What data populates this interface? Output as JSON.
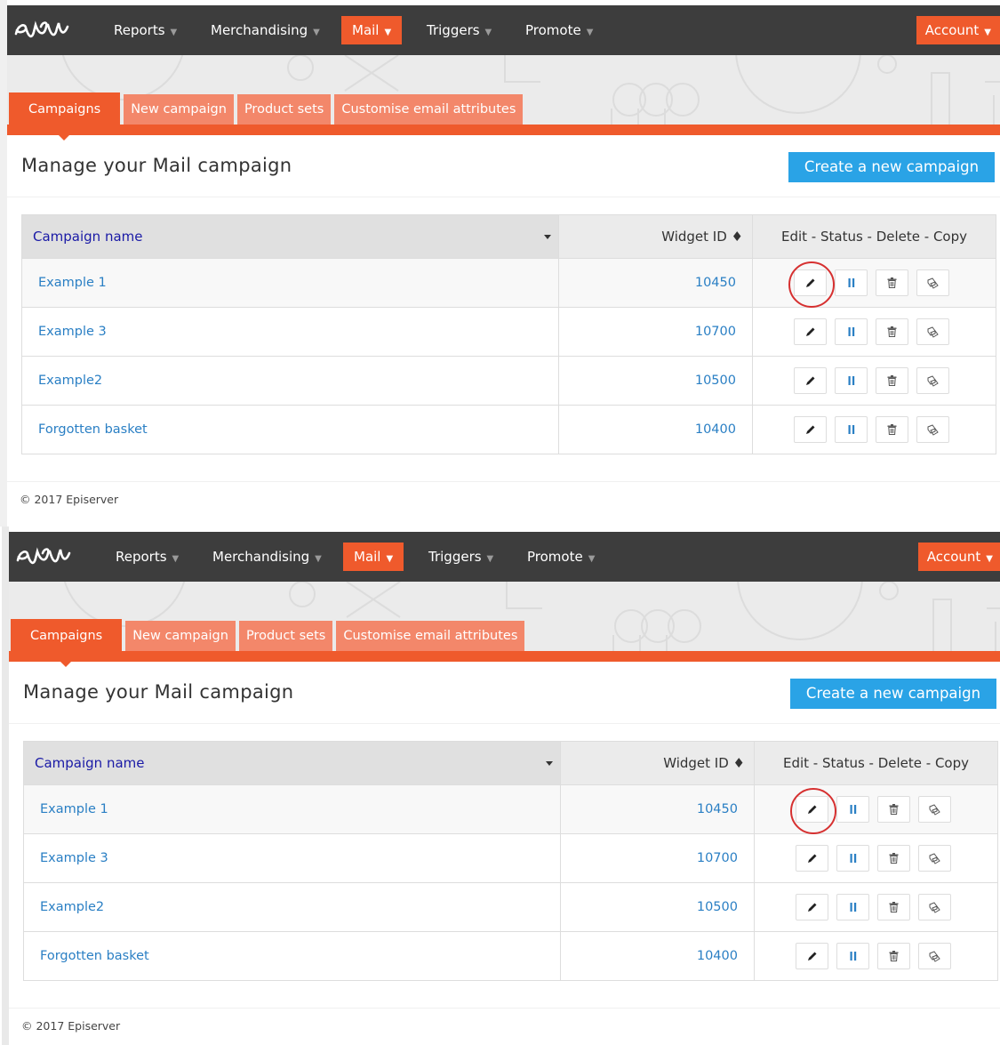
{
  "nav": {
    "items": [
      {
        "label": "Reports",
        "active": false
      },
      {
        "label": "Merchandising",
        "active": false
      },
      {
        "label": "Mail",
        "active": true
      },
      {
        "label": "Triggers",
        "active": false
      },
      {
        "label": "Promote",
        "active": false
      }
    ],
    "account_label": "Account"
  },
  "subtabs": [
    "Campaigns",
    "New campaign",
    "Product sets",
    "Customise email attributes"
  ],
  "page_title": "Manage your Mail campaign",
  "create_button": "Create a new campaign",
  "table": {
    "headers": {
      "name": "Campaign name",
      "widget_id": "Widget ID ♦",
      "actions": "Edit - Status - Delete - Copy"
    },
    "rows": [
      {
        "name": "Example 1",
        "widget_id": "10450"
      },
      {
        "name": "Example 3",
        "widget_id": "10700"
      },
      {
        "name": "Example2",
        "widget_id": "10500"
      },
      {
        "name": "Forgotten basket",
        "widget_id": "10400"
      }
    ],
    "action_icons": [
      "pencil-icon",
      "pause-icon",
      "trash-icon",
      "copy-icon"
    ],
    "highlighted_action": "edit on row 1"
  },
  "footer": "© 2017 Episerver",
  "colors": {
    "nav_bg": "#3d3d3d",
    "accent": "#ef5a2c",
    "tab_inactive": "#f3876a",
    "button_blue": "#2aa3e6",
    "link": "#2a7fc4",
    "highlight_circle": "#d63030"
  }
}
